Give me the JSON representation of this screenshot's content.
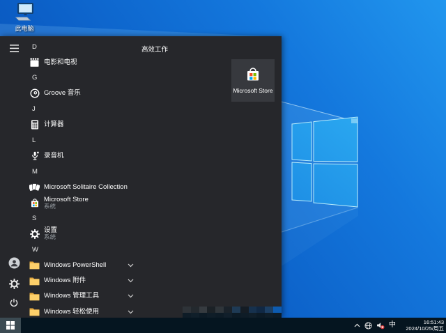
{
  "desktop": {
    "icons": [
      {
        "icon": "this-pc-icon",
        "label": "此电脑"
      }
    ]
  },
  "start_menu": {
    "rail": {
      "menu_icon": "hamburger-icon",
      "user_icon": "user-icon",
      "settings_icon": "gear-icon",
      "power_icon": "power-icon"
    },
    "app_list": [
      {
        "type": "header",
        "label": "D"
      },
      {
        "type": "app",
        "icon": "movies-tv-icon",
        "label": "电影和电视"
      },
      {
        "type": "header",
        "label": "G"
      },
      {
        "type": "app",
        "icon": "groove-music-icon",
        "label": "Groove 音乐"
      },
      {
        "type": "header",
        "label": "J"
      },
      {
        "type": "app",
        "icon": "calculator-icon",
        "label": "计算器"
      },
      {
        "type": "header",
        "label": "L"
      },
      {
        "type": "app",
        "icon": "voice-recorder-icon",
        "label": "录音机"
      },
      {
        "type": "header",
        "label": "M"
      },
      {
        "type": "app",
        "icon": "solitaire-icon",
        "label": "Microsoft Solitaire Collection"
      },
      {
        "type": "app",
        "icon": "store-icon",
        "label": "Microsoft Store",
        "sublabel": "系统"
      },
      {
        "type": "header",
        "label": "S"
      },
      {
        "type": "app",
        "icon": "gear-icon",
        "label": "设置",
        "sublabel": "系统"
      },
      {
        "type": "header",
        "label": "W"
      },
      {
        "type": "folder",
        "icon": "folder-icon",
        "label": "Windows PowerShell",
        "expand_icon": "chevron-down-icon"
      },
      {
        "type": "folder",
        "icon": "folder-icon",
        "label": "Windows 附件",
        "expand_icon": "chevron-down-icon"
      },
      {
        "type": "folder",
        "icon": "folder-icon",
        "label": "Windows 管理工具",
        "expand_icon": "chevron-down-icon"
      },
      {
        "type": "folder",
        "icon": "folder-icon",
        "label": "Windows 轻松使用",
        "expand_icon": "chevron-down-icon"
      }
    ],
    "tiles": {
      "group_title": "高效工作",
      "tiles": [
        {
          "icon": "store-bag-icon",
          "label": "Microsoft Store"
        }
      ]
    }
  },
  "taskbar": {
    "start_button_icon": "windows-logo-icon",
    "tray": {
      "hidden_icons": "chevron-up-icon",
      "network_icon": "globe-icon",
      "volume_icon": "speaker-muted-icon",
      "ime": "中",
      "time": "16:51:43",
      "date": "2024/10/25/周五"
    }
  },
  "colors": {
    "wallpaper_dark": "#0848a8",
    "wallpaper_light": "#2196ee",
    "menu_bg": "#26272b",
    "tile_bg": "#37393e",
    "taskbar_bg": "#051520",
    "start_button_bg": "#3b4a52",
    "folder_yellow": "#fdd06a",
    "store_red": "#f25022",
    "store_green": "#7fba00",
    "store_blue": "#00a4ef",
    "store_yellow": "#ffb900",
    "mute_badge": "#e03a3a"
  },
  "mosaic": {
    "rows": [
      [
        "#2e3338",
        "#23292e",
        "#363b40",
        "#1b2126",
        "#2f353a",
        "#1a222a",
        "#1e3a55",
        "#141c24",
        "#16314e",
        "#102844",
        "#1c3f64",
        "#0d5bb0"
      ],
      [
        "#0e1c27",
        "#101f2a",
        "#0c1a25",
        "#0f1d28",
        "#0d1b26",
        "#111f2b",
        "#0c1a25",
        "#0e1c27",
        "#101e29",
        "#0c1a25",
        "#0f1d28",
        "#0d1b26"
      ]
    ]
  }
}
